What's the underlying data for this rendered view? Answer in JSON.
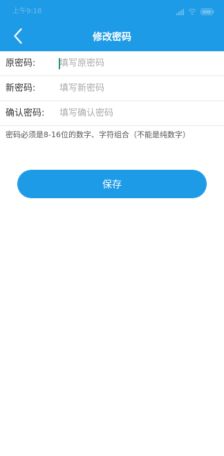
{
  "status_bar": {
    "time": "上午9:18",
    "icons": [
      "signal-icon",
      "wifi-icon",
      "battery-icon"
    ]
  },
  "header": {
    "title": "修改密码",
    "back_icon": "chevron-left-icon",
    "background_color": "#1e9be6"
  },
  "form": {
    "old_password": {
      "label": "原密码:",
      "placeholder": "填写原密码",
      "value": ""
    },
    "new_password": {
      "label": "新密码:",
      "placeholder": "填写新密码",
      "value": ""
    },
    "confirm_password": {
      "label": "确认密码:",
      "placeholder": "填写确认密码",
      "value": ""
    }
  },
  "hint": "密码必须是8-16位的数字、字符组合（不能是纯数字）",
  "save_button": {
    "label": "保存",
    "color": "#1e9be6"
  }
}
